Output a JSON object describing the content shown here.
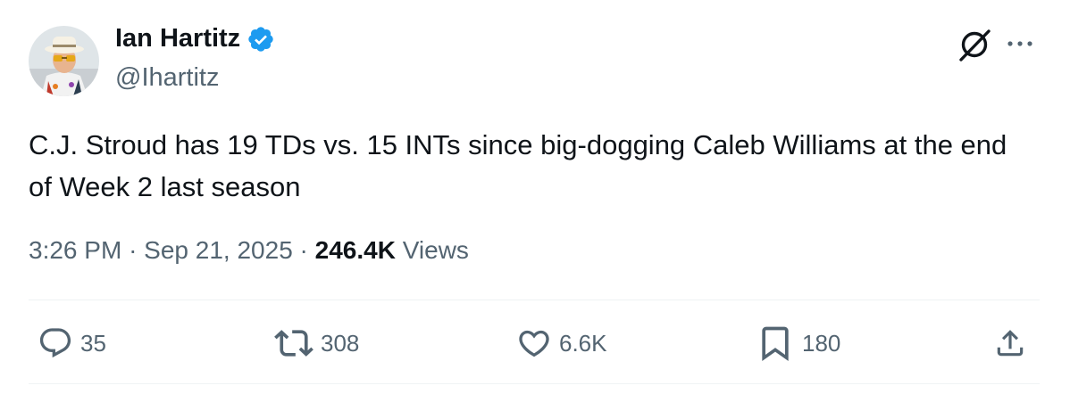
{
  "author": {
    "display_name": "Ian Hartitz",
    "handle": "@Ihartitz",
    "verified_icon": "verified-badge-icon"
  },
  "tweet": {
    "text": "C.J. Stroud has 19 TDs vs. 15 INTs since big-dogging Caleb Williams at the end of Week 2 last season"
  },
  "meta": {
    "time": "3:26 PM",
    "separator": "·",
    "date": "Sep 21, 2025",
    "views_count": "246.4K",
    "views_label": "Views"
  },
  "actions": {
    "replies": "35",
    "reposts": "308",
    "likes": "6.6K",
    "bookmarks": "180"
  },
  "colors": {
    "text": "#0f1419",
    "secondary": "#536471",
    "verified": "#1d9bf0",
    "divider": "#eff3f4"
  }
}
